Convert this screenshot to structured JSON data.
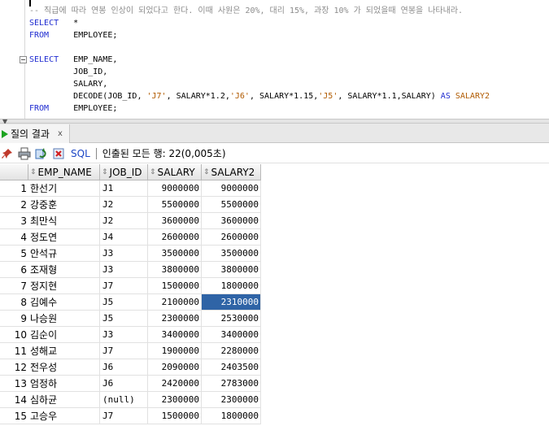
{
  "editor": {
    "lines": [
      {
        "parts": [
          {
            "t": "-- 직급에 따라 연봉 인상이 되었다고 한다. 이때 사원은 20%, 대리 15%, 과장 10% 가 되었을때 연봉을 나타내라.",
            "c": "cmt"
          }
        ]
      },
      {
        "parts": [
          {
            "t": "SELECT",
            "c": "kw"
          },
          {
            "t": "   *",
            "c": "pl"
          }
        ]
      },
      {
        "parts": [
          {
            "t": "FROM",
            "c": "kw"
          },
          {
            "t": "     EMPLOYEE;",
            "c": "pl"
          }
        ]
      },
      {
        "parts": []
      },
      {
        "parts": [
          {
            "t": "SELECT",
            "c": "kw"
          },
          {
            "t": "   EMP_NAME,",
            "c": "pl"
          }
        ]
      },
      {
        "parts": [
          {
            "t": "         JOB_ID,",
            "c": "pl"
          }
        ]
      },
      {
        "parts": [
          {
            "t": "         SALARY,",
            "c": "pl"
          }
        ]
      },
      {
        "parts": [
          {
            "t": "         DECODE(JOB_ID, ",
            "c": "pl"
          },
          {
            "t": "'J7'",
            "c": "str"
          },
          {
            "t": ", SALARY*1.2,",
            "c": "pl"
          },
          {
            "t": "'J6'",
            "c": "str"
          },
          {
            "t": ", SALARY*1.15,",
            "c": "pl"
          },
          {
            "t": "'J5'",
            "c": "str"
          },
          {
            "t": ", SALARY*1.1,SALARY) ",
            "c": "pl"
          },
          {
            "t": "AS",
            "c": "kw"
          },
          {
            "t": " ",
            "c": "pl"
          },
          {
            "t": "SALARY2",
            "c": "alias"
          }
        ]
      },
      {
        "parts": [
          {
            "t": "FROM",
            "c": "kw"
          },
          {
            "t": "     EMPLOYEE;",
            "c": "pl"
          }
        ]
      }
    ]
  },
  "result_tab": {
    "label": "질의 결과",
    "close": "x"
  },
  "toolbar": {
    "sql_label": "SQL",
    "status": "인출된 모든 행: 22(0,005초)"
  },
  "grid": {
    "columns": [
      "EMP_NAME",
      "JOB_ID",
      "SALARY",
      "SALARY2"
    ],
    "rows": [
      [
        "1",
        "한선기",
        "J1",
        "9000000",
        "9000000"
      ],
      [
        "2",
        "강중훈",
        "J2",
        "5500000",
        "5500000"
      ],
      [
        "3",
        "최만식",
        "J2",
        "3600000",
        "3600000"
      ],
      [
        "4",
        "정도연",
        "J4",
        "2600000",
        "2600000"
      ],
      [
        "5",
        "안석규",
        "J3",
        "3500000",
        "3500000"
      ],
      [
        "6",
        "조재형",
        "J3",
        "3800000",
        "3800000"
      ],
      [
        "7",
        "정지현",
        "J7",
        "1500000",
        "1800000"
      ],
      [
        "8",
        "김예수",
        "J5",
        "2100000",
        "2310000"
      ],
      [
        "9",
        "나승원",
        "J5",
        "2300000",
        "2530000"
      ],
      [
        "10",
        "김순이",
        "J3",
        "3400000",
        "3400000"
      ],
      [
        "11",
        "성해교",
        "J7",
        "1900000",
        "2280000"
      ],
      [
        "12",
        "전우성",
        "J6",
        "2090000",
        "2403500"
      ],
      [
        "13",
        "엄정하",
        "J6",
        "2420000",
        "2783000"
      ],
      [
        "14",
        "심하균",
        "(null)",
        "2300000",
        "2300000"
      ],
      [
        "15",
        "고승우",
        "J7",
        "1500000",
        "1800000"
      ]
    ],
    "selected_row": 8
  },
  "colors": {
    "keyword": "#1e2bd0",
    "string": "#b05a00",
    "comment": "#8c8c8c",
    "selection": "#2f64a6"
  }
}
